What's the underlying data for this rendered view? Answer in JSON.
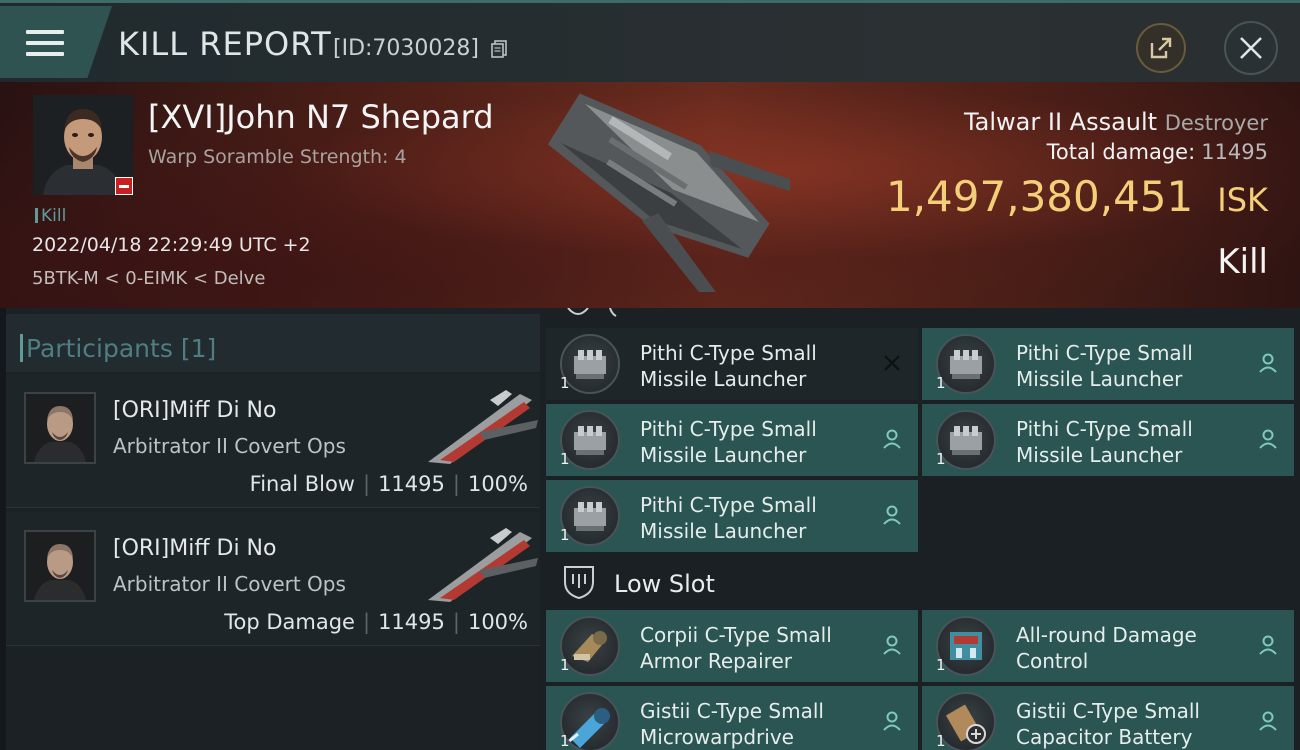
{
  "header": {
    "title": "KILL REPORT",
    "kill_id": "[ID:7030028]"
  },
  "victim": {
    "pilot_name": "[XVI]John N7 Shepard",
    "warp_scramble": "Warp Soramble Strength: 4",
    "tag": "Kill",
    "datetime": "2022/04/18 22:29:49 UTC +2",
    "location": "5BTK-M < 0-EIMK < Delve",
    "ship_name": "Talwar II Assault",
    "ship_class": "Destroyer",
    "total_damage_label": "Total damage:",
    "total_damage_value": "11495",
    "isk_value": "1,497,380,451",
    "isk_unit": "ISK",
    "result_label": "Kill"
  },
  "participants": {
    "title": "Participants",
    "count": "[1]",
    "cards": [
      {
        "name": "[ORI]Miff Di No",
        "ship": "Arbitrator II Covert Ops",
        "role": "Final Blow",
        "damage": "11495",
        "percent": "100%"
      },
      {
        "name": "[ORI]Miff Di No",
        "ship": "Arbitrator II Covert Ops",
        "role": "Top Damage",
        "damage": "11495",
        "percent": "100%"
      }
    ]
  },
  "modules": {
    "mid_rows": [
      {
        "line1": "Pithi C-Type Small",
        "line2": "Missile Launcher",
        "qty": "1",
        "status": "destroyed"
      },
      {
        "line1": "Pithi C-Type Small",
        "line2": "Missile Launcher",
        "qty": "1",
        "status": "dropped"
      },
      {
        "line1": "Pithi C-Type Small",
        "line2": "Missile Launcher",
        "qty": "1",
        "status": "dropped"
      },
      {
        "line1": "Pithi C-Type Small",
        "line2": "Missile Launcher",
        "qty": "1",
        "status": "dropped"
      },
      {
        "line1": "Pithi C-Type Small",
        "line2": "Missile Launcher",
        "qty": "1",
        "status": "dropped"
      }
    ],
    "low_slot_title": "Low Slot",
    "low_rows": [
      {
        "line1": "Corpii C-Type Small",
        "line2": "Armor Repairer",
        "qty": "1",
        "status": "dropped"
      },
      {
        "line1": "All-round Damage",
        "line2": "Control",
        "qty": "1",
        "status": "dropped"
      },
      {
        "line1": "Gistii C-Type Small",
        "line2": "Microwarpdrive",
        "qty": "1",
        "status": "dropped"
      },
      {
        "line1": "Gistii C-Type Small",
        "line2": "Capacitor Battery",
        "qty": "1",
        "status": "dropped"
      }
    ]
  },
  "colors": {
    "accent_teal": "#2a5552",
    "isk_gold": "#f4cf7a",
    "banner_red": "#6b2d1f"
  },
  "icons": [
    "menu-icon",
    "copy-icon",
    "share-icon",
    "close-icon",
    "person-icon",
    "x-icon",
    "shield-slot-icon"
  ]
}
